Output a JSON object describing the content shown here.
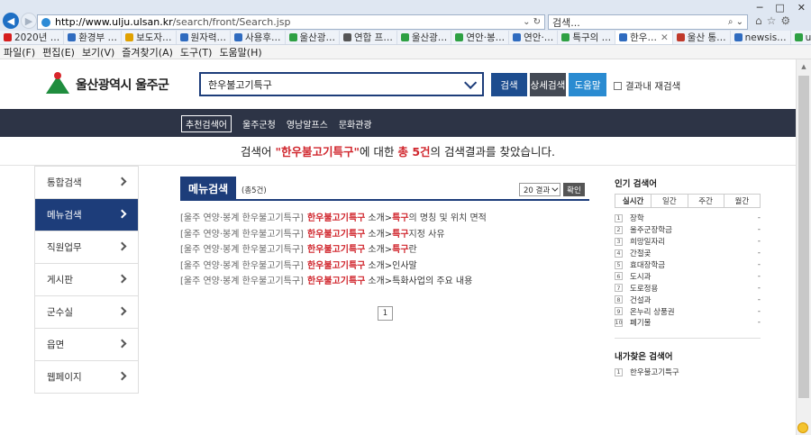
{
  "browser": {
    "window_controls": [
      "─",
      "□",
      "✕"
    ],
    "url_host": "http://www.ulju.ulsan.kr",
    "url_rest": "/search/front/Search.jsp",
    "url_tools": "⌄ ↻",
    "search_placeholder": "검색...",
    "search_tools": "⌕ ⌄",
    "right_icons": [
      "⌂",
      "☆",
      "⚙"
    ],
    "favorites": [
      {
        "label": "2020년 …",
        "color": "#d61e1e"
      },
      {
        "label": "환경부 …",
        "color": "#2f6bbf"
      },
      {
        "label": "보도자…",
        "color": "#e0a100"
      },
      {
        "label": "원자력…",
        "color": "#2f6bbf"
      },
      {
        "label": "사용후…",
        "color": "#2f6bbf"
      },
      {
        "label": "울산광…",
        "color": "#2ea043"
      },
      {
        "label": "연합 프…",
        "color": "#555555"
      },
      {
        "label": "울산광…",
        "color": "#2ea043"
      },
      {
        "label": "연안·봉…",
        "color": "#2ea043"
      },
      {
        "label": "연안·…",
        "color": "#2f6bbf"
      },
      {
        "label": "특구의 …",
        "color": "#2ea043"
      },
      {
        "label": "한우…",
        "color": "#2f6bbf",
        "active": true
      },
      {
        "label": "울산 통…",
        "color": "#c0392b"
      },
      {
        "label": "newsis…",
        "color": "#2f6bbf"
      },
      {
        "label": "ulsanna…",
        "color": "#2ea043"
      }
    ],
    "tab_close": "✕",
    "menu": [
      "파일(F)",
      "편집(E)",
      "보기(V)",
      "즐겨찾기(A)",
      "도구(T)",
      "도움말(H)"
    ]
  },
  "site": {
    "logo_text": "울산광역시 울주군",
    "query": "한우불고기특구",
    "buttons": {
      "search": "검색",
      "detail": "상세검색",
      "help": "도움말"
    },
    "re_search": "결과내 재검색",
    "nav": [
      "추천검색어",
      "울주군청",
      "영남알프스",
      "문화관광"
    ]
  },
  "summary": {
    "prefix": "검색어 ",
    "quoted": "\"한우불고기특구\"",
    "mid": "에 대한 ",
    "count": "총 5건",
    "suffix": "의 검색결과를 찾았습니다."
  },
  "side_menu": [
    {
      "label": "통합검색",
      "active": false
    },
    {
      "label": "메뉴검색",
      "active": true
    },
    {
      "label": "직원업무",
      "active": false
    },
    {
      "label": "게시판",
      "active": false
    },
    {
      "label": "군수실",
      "active": false
    },
    {
      "label": "읍면",
      "active": false
    },
    {
      "label": "웹페이지",
      "active": false
    }
  ],
  "results": {
    "title": "메뉴검색",
    "count": "(총5건)",
    "per_page": "20 결과",
    "ok": "확인",
    "rows": [
      {
        "path": "[울주 연양·봉계 한우불고기특구]",
        "kw": "한우불고기특구",
        "rest_a": "소개>",
        "kw2": "특구",
        "rest_b": "의 명칭 및 위치 면적"
      },
      {
        "path": "[울주 연양·봉계 한우불고기특구]",
        "kw": "한우불고기특구",
        "rest_a": "소개>",
        "kw2": "특구",
        "rest_b": "지정 사유"
      },
      {
        "path": "[울주 연양·봉계 한우불고기특구]",
        "kw": "한우불고기특구",
        "rest_a": "소개>",
        "kw2": "특구",
        "rest_b": "란"
      },
      {
        "path": "[울주 연양·봉계 한우불고기특구]",
        "kw": "한우불고기특구",
        "rest_a": "소개>인사말",
        "kw2": "",
        "rest_b": ""
      },
      {
        "path": "[울주 연양·봉계 한우불고기특구]",
        "kw": "한우불고기특구",
        "rest_a": "소개>특화사업의 주요 내용",
        "kw2": "",
        "rest_b": ""
      }
    ],
    "page": "1"
  },
  "popular": {
    "title": "인기 검색어",
    "tabs": [
      "실시간",
      "일간",
      "주간",
      "월간"
    ],
    "items": [
      "장학",
      "울주군장학금",
      "희망일자리",
      "간절곶",
      "효대장학금",
      "도시과",
      "도로정용",
      "건설과",
      "온누리 상품권",
      "폐기물"
    ],
    "dash": "-"
  },
  "my_searches": {
    "title": "내가찾은 검색어",
    "items": [
      "한우불고기특구"
    ]
  }
}
